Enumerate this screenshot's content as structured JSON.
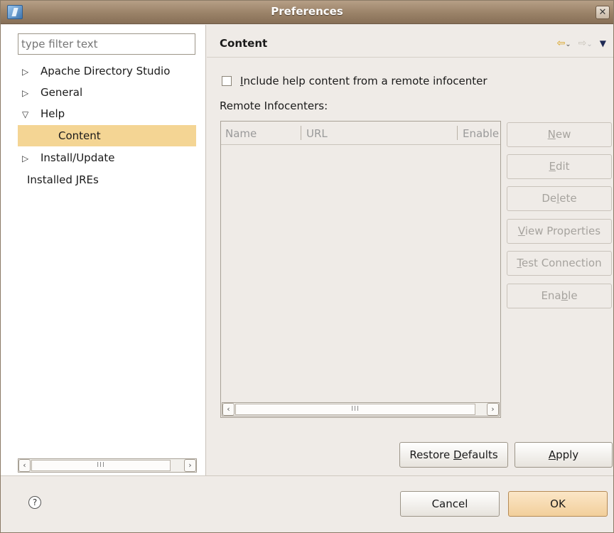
{
  "window": {
    "title": "Preferences",
    "close_glyph": "✕",
    "app_icon": "eclipse-app-icon"
  },
  "left": {
    "filter_placeholder": "type filter text",
    "tree": [
      {
        "label": "Apache Directory Studio",
        "expander": "▷"
      },
      {
        "label": "General",
        "expander": "▷"
      },
      {
        "label": "Help",
        "expander": "▽"
      },
      {
        "label": "Content",
        "expander": "",
        "selected": true
      },
      {
        "label": "Install/Update",
        "expander": "▷"
      },
      {
        "label": "Installed JREs",
        "expander": ""
      }
    ],
    "scroll_thumb": "III"
  },
  "right": {
    "page_title": "Content",
    "nav": {
      "back": "⇦",
      "back_dd": "⌄",
      "fwd": "⇨",
      "fwd_dd": "⌄",
      "menu": "▼"
    },
    "checkbox_label_prefix": "",
    "checkbox_mnemonic": "I",
    "checkbox_label_rest": "nclude help content from a remote infocenter",
    "remote_label": "Remote Infocenters:",
    "columns": [
      "Name",
      "URL",
      "Enable"
    ],
    "buttons": {
      "new": {
        "pre": "",
        "m": "N",
        "post": "ew"
      },
      "edit": {
        "pre": "",
        "m": "E",
        "post": "dit"
      },
      "delete": {
        "pre": "De",
        "m": "l",
        "post": "ete"
      },
      "view": {
        "pre": "",
        "m": "V",
        "post": "iew Properties"
      },
      "test": {
        "pre": "",
        "m": "T",
        "post": "est Connection"
      },
      "enable": {
        "pre": "Ena",
        "m": "b",
        "post": "le"
      }
    },
    "scroll_thumb": "III",
    "restore": {
      "pre": "Restore ",
      "m": "D",
      "post": "efaults"
    },
    "apply": {
      "pre": "",
      "m": "A",
      "post": "pply"
    }
  },
  "footer": {
    "help_glyph": "?",
    "cancel": "Cancel",
    "ok": "OK"
  },
  "colors": {
    "selection": "#f4d594",
    "title_bar": "#9a8268",
    "window_bg": "#efebe7",
    "disabled_text": "#a6a39e"
  }
}
